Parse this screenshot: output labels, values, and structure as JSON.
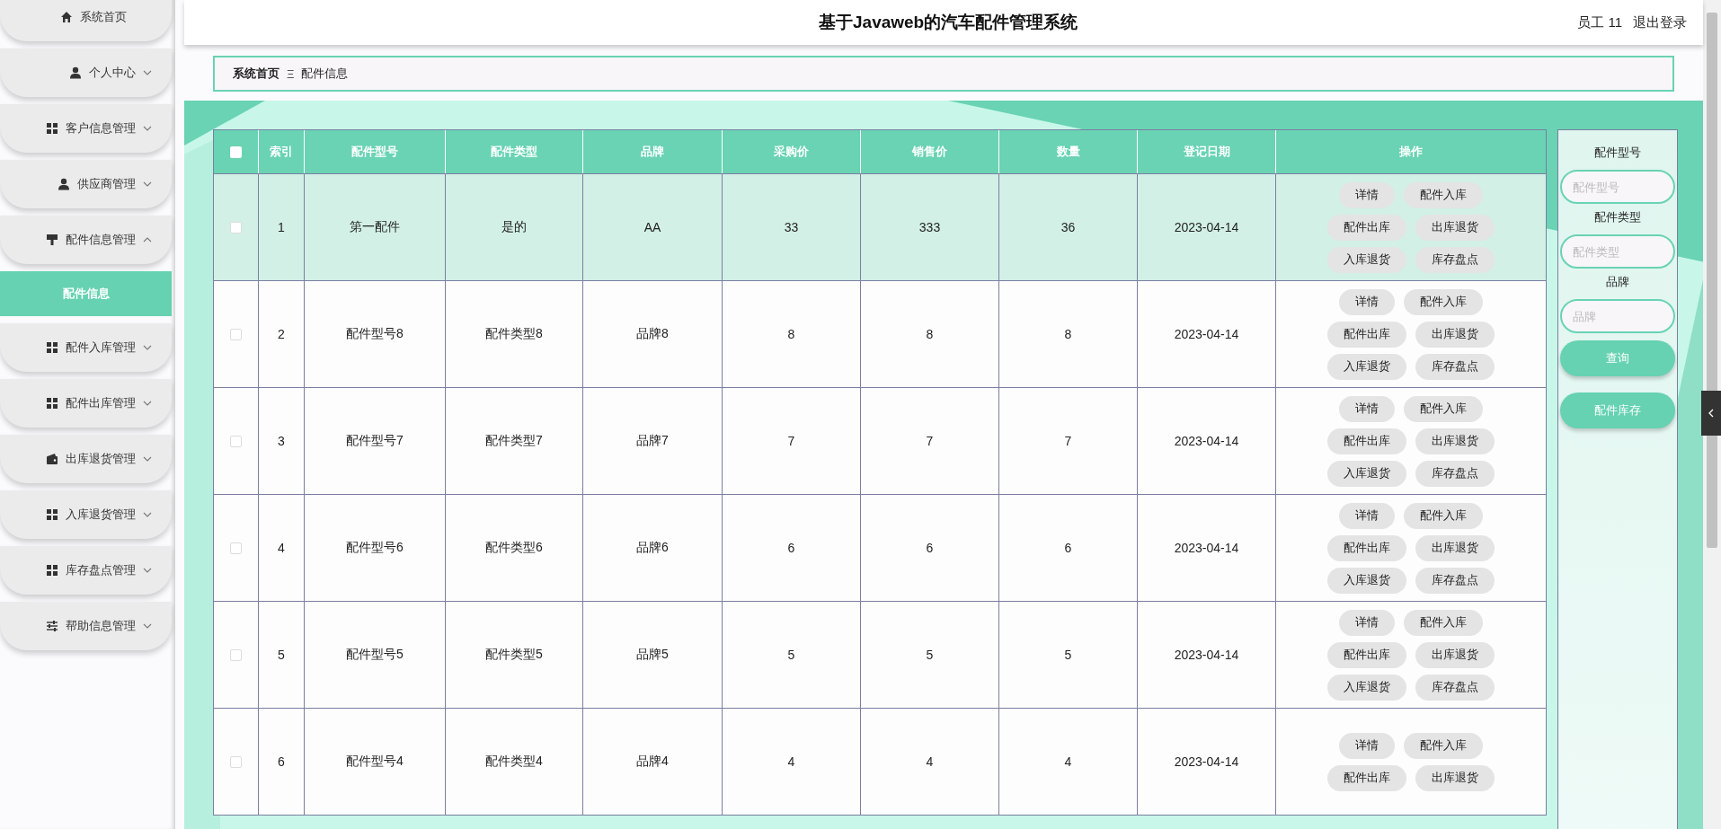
{
  "sidebar": {
    "items": [
      {
        "label": "系统首页",
        "kind": "link"
      },
      {
        "label": "个人中心",
        "kind": "menu",
        "expanded": false
      },
      {
        "label": "客户信息管理",
        "kind": "menu",
        "expanded": false
      },
      {
        "label": "供应商管理",
        "kind": "menu",
        "expanded": false
      },
      {
        "label": "配件信息管理",
        "kind": "menu",
        "expanded": true,
        "children": [
          {
            "label": "配件信息",
            "selected": true
          }
        ]
      },
      {
        "label": "配件入库管理",
        "kind": "menu",
        "expanded": false
      },
      {
        "label": "配件出库管理",
        "kind": "menu",
        "expanded": false
      },
      {
        "label": "出库退货管理",
        "kind": "menu",
        "expanded": false
      },
      {
        "label": "入库退货管理",
        "kind": "menu",
        "expanded": false
      },
      {
        "label": "库存盘点管理",
        "kind": "menu",
        "expanded": false
      },
      {
        "label": "帮助信息管理",
        "kind": "menu",
        "expanded": false
      }
    ]
  },
  "header": {
    "title": "基于Javaweb的汽车配件管理系统",
    "user": "员工 11",
    "logout": "退出登录"
  },
  "breadcrumb": {
    "items": [
      "系统首页",
      "配件信息"
    ],
    "separator": "Ξ"
  },
  "table": {
    "header_checkbox": {
      "checked": false
    },
    "columns": [
      "索引",
      "配件型号",
      "配件类型",
      "品牌",
      "采购价",
      "销售价",
      "数量",
      "登记日期",
      "操作"
    ],
    "rows": [
      {
        "checked": false,
        "selected": true,
        "cells": [
          "1",
          "第一配件",
          "是的",
          "AA",
          "33",
          "333",
          "36",
          "2023-04-14"
        ],
        "actions": [
          "详情",
          "配件入库",
          "配件出库",
          "出库退货",
          "入库退货",
          "库存盘点"
        ]
      },
      {
        "checked": false,
        "selected": false,
        "cells": [
          "2",
          "配件型号8",
          "配件类型8",
          "品牌8",
          "8",
          "8",
          "8",
          "2023-04-14"
        ],
        "actions": [
          "详情",
          "配件入库",
          "配件出库",
          "出库退货",
          "入库退货",
          "库存盘点"
        ]
      },
      {
        "checked": false,
        "selected": false,
        "cells": [
          "3",
          "配件型号7",
          "配件类型7",
          "品牌7",
          "7",
          "7",
          "7",
          "2023-04-14"
        ],
        "actions": [
          "详情",
          "配件入库",
          "配件出库",
          "出库退货",
          "入库退货",
          "库存盘点"
        ]
      },
      {
        "checked": false,
        "selected": false,
        "cells": [
          "4",
          "配件型号6",
          "配件类型6",
          "品牌6",
          "6",
          "6",
          "6",
          "2023-04-14"
        ],
        "actions": [
          "详情",
          "配件入库",
          "配件出库",
          "出库退货",
          "入库退货",
          "库存盘点"
        ]
      },
      {
        "checked": false,
        "selected": false,
        "cells": [
          "5",
          "配件型号5",
          "配件类型5",
          "品牌5",
          "5",
          "5",
          "5",
          "2023-04-14"
        ],
        "actions": [
          "详情",
          "配件入库",
          "配件出库",
          "出库退货",
          "入库退货",
          "库存盘点"
        ]
      },
      {
        "checked": false,
        "selected": false,
        "cells": [
          "6",
          "配件型号4",
          "配件类型4",
          "品牌4",
          "4",
          "4",
          "4",
          "2023-04-14"
        ],
        "actions": [
          "详情",
          "配件入库",
          "配件出库",
          "出库退货"
        ]
      }
    ]
  },
  "search": {
    "fields": [
      {
        "label": "配件型号",
        "placeholder": "配件型号"
      },
      {
        "label": "配件类型",
        "placeholder": "配件类型"
      },
      {
        "label": "品牌",
        "placeholder": "品牌"
      }
    ],
    "buttons": [
      "查询",
      "配件库存"
    ]
  }
}
